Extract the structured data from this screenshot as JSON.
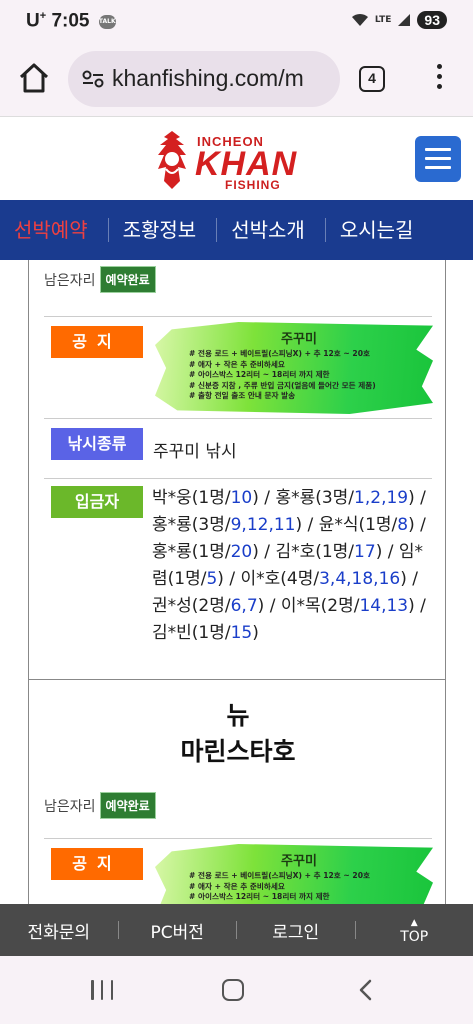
{
  "status_bar": {
    "carrier": "U",
    "carrier_sup": "+",
    "time": "7:05",
    "talk_icon": "TALK",
    "wifi_icon": "wifi-icon",
    "network": "LTE",
    "battery": "93"
  },
  "browser": {
    "url": "khanfishing.com/m",
    "tab_count": "4"
  },
  "site": {
    "logo_top": "INCHEON",
    "logo_main": "KHAN",
    "logo_bottom": "FISHING"
  },
  "nav": {
    "items": [
      "선박예약",
      "조황정보",
      "선박소개",
      "오시는길"
    ]
  },
  "card1": {
    "seats_label": "남은자리",
    "seats_badge": "예약완료",
    "notice_label": "공지",
    "notice_title": "주꾸미",
    "notice_lines": [
      "# 전용 로드 + 베이트릴(스피닝X) + 추 12호 ~ 20호",
      "# 애자 + 작은 추 준비하세요",
      "# 아이스박스 12리터 ~ 18리터 까지 제한",
      "# 신분증 지참 , 주류 반입 금지(얼음에 들어간 모든 제품)",
      "# 출항 전일 출조 안내 문자 발송"
    ],
    "type_label": "낚시종류",
    "type_value": "주꾸미 낚시",
    "deposit_label": "입금자",
    "depositors": [
      {
        "name": "박*웅",
        "count": "1명",
        "seats": "10"
      },
      {
        "name": "홍*룡",
        "count": "3명",
        "seats": "1,2,19"
      },
      {
        "name": "홍*룡",
        "count": "3명",
        "seats": "9,12,11"
      },
      {
        "name": "윤*식",
        "count": "1명",
        "seats": "8"
      },
      {
        "name": "홍*룡",
        "count": "1명",
        "seats": "20"
      },
      {
        "name": "김*호",
        "count": "1명",
        "seats": "17"
      },
      {
        "name": "임*렴",
        "count": "1명",
        "seats": "5"
      },
      {
        "name": "이*호",
        "count": "4명",
        "seats": "3,4,18,16"
      },
      {
        "name": "권*성",
        "count": "2명",
        "seats": "6,7"
      },
      {
        "name": "이*목",
        "count": "2명",
        "seats": "14,13"
      },
      {
        "name": "김*빈",
        "count": "1명",
        "seats": "15"
      }
    ]
  },
  "card2": {
    "ship_name_line1": "뉴",
    "ship_name_line2": "마린스타호",
    "seats_label": "남은자리",
    "seats_badge": "예약완료",
    "notice_label": "공지",
    "notice_title": "주꾸미",
    "notice_lines": [
      "# 전용 로드 + 베이트릴(스피닝X) + 추 12호 ~ 20호",
      "# 애자 + 작은 추 준비하세요",
      "# 아이스박스 12리터 ~ 18리터 까지 제한"
    ]
  },
  "bottom_bar": {
    "items": [
      "전화문의",
      "PC버전",
      "로그인"
    ],
    "top_label": "TOP"
  }
}
